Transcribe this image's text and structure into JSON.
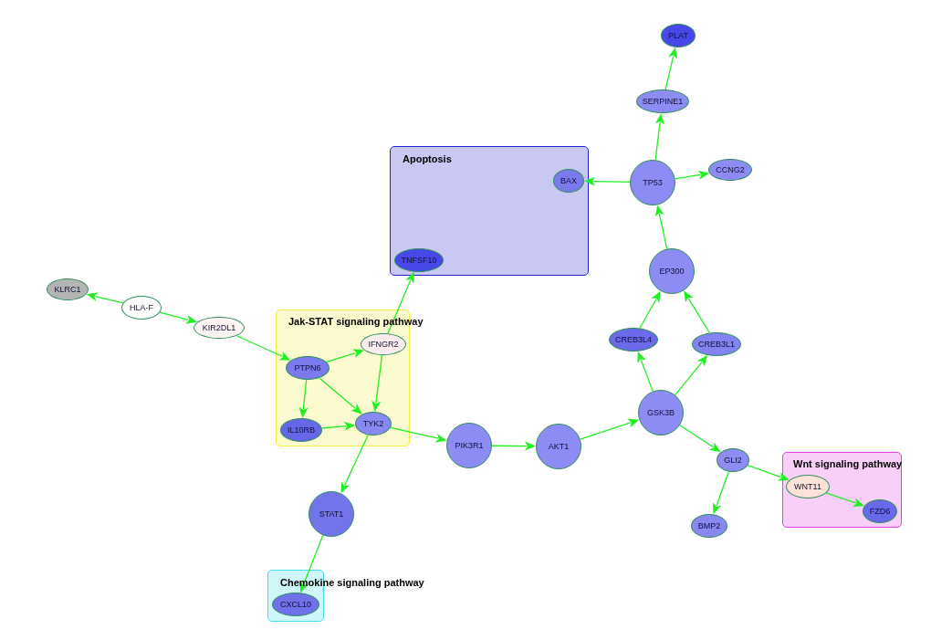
{
  "nodes": [
    {
      "label": "PLAT",
      "kind": "ellipse",
      "color": "#4848e8"
    },
    {
      "label": "SERPINE1",
      "kind": "ellipse",
      "color": "#8c8cf2"
    },
    {
      "label": "TP53",
      "kind": "circle",
      "color": "#8c8cf4"
    },
    {
      "label": "CCNG2",
      "kind": "ellipse",
      "color": "#8c8cf2"
    },
    {
      "label": "EP300",
      "kind": "circle",
      "color": "#8c8cf4"
    },
    {
      "label": "KLRC1",
      "kind": "ellipse",
      "color": "#b4b4b4"
    },
    {
      "label": "HLA-F",
      "kind": "ellipse",
      "color": "#ffffff"
    },
    {
      "label": "KIR2DL1",
      "kind": "ellipse",
      "color": "#fff4f4"
    },
    {
      "label": "CREB3L4",
      "kind": "ellipse",
      "color": "#6a6aea"
    },
    {
      "label": "CREB3L1",
      "kind": "ellipse",
      "color": "#8282f0"
    },
    {
      "label": "GSK3B",
      "kind": "circle",
      "color": "#8c8cf4"
    },
    {
      "label": "PIK3R1",
      "kind": "circle",
      "color": "#8c8cf4"
    },
    {
      "label": "AKT1",
      "kind": "circle",
      "color": "#8c8cf4"
    },
    {
      "label": "GLI2",
      "kind": "ellipse",
      "color": "#8c8cf2"
    },
    {
      "label": "STAT1",
      "kind": "circle",
      "color": "#7474ea"
    },
    {
      "label": "BMP2",
      "kind": "ellipse",
      "color": "#8888f0"
    }
  ],
  "groups": [
    {
      "title": "Apoptosis",
      "color": "#2222cc",
      "nodes": [
        {
          "label": "BAX",
          "kind": "ellipse",
          "color": "#7a7aee"
        },
        {
          "label": "TNFSF10",
          "kind": "ellipse",
          "color": "#4848e8"
        }
      ]
    },
    {
      "title": "Jak-STAT signaling pathway",
      "color": "#f0f040",
      "nodes": [
        {
          "label": "IFNGR2",
          "kind": "ellipse",
          "color": "#fdeeee"
        },
        {
          "label": "PTPN6",
          "kind": "ellipse",
          "color": "#7a7aec"
        },
        {
          "label": "IL10RB",
          "kind": "ellipse",
          "color": "#6666e8"
        },
        {
          "label": "TYK2",
          "kind": "ellipse",
          "color": "#8888f2"
        }
      ]
    },
    {
      "title": "Wnt signaling pathway",
      "color": "#e040e0",
      "nodes": [
        {
          "label": "WNT11",
          "kind": "ellipse",
          "color": "#fde2da"
        },
        {
          "label": "FZD6",
          "kind": "ellipse",
          "color": "#6868ea"
        }
      ]
    },
    {
      "title": "Chemokine signaling pathway",
      "color": "#40e0e8",
      "nodes": [
        {
          "label": "CXCL10",
          "kind": "ellipse",
          "color": "#7070ea"
        }
      ]
    }
  ]
}
